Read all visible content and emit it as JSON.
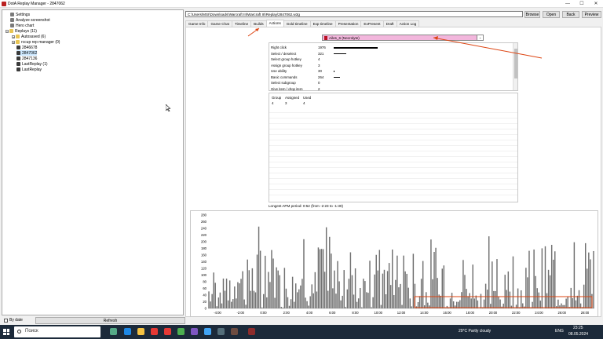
{
  "window": {
    "title": "DotA Replay Manager - 2847062",
    "minimize": "—",
    "maximize": "☐",
    "close": "✕"
  },
  "tree": {
    "items": [
      {
        "label": "Settings",
        "icon": "gear-icon"
      },
      {
        "label": "Analyze screenshot",
        "icon": "gear-icon"
      },
      {
        "label": "Hero chart",
        "icon": "gear-icon"
      },
      {
        "label": "Replays (11)",
        "icon": "folder-icon"
      },
      {
        "label": "Autosaved (6)",
        "icon": "folder-icon"
      },
      {
        "label": "rccup rep manager (0)",
        "icon": "folder-icon"
      },
      {
        "label": "2846678",
        "icon": "replay-icon"
      },
      {
        "label": "2847062",
        "icon": "replay-icon"
      },
      {
        "label": "2847136",
        "icon": "replay-icon"
      },
      {
        "label": "LastReplay (1)",
        "icon": "replay-icon"
      },
      {
        "label": "LastReplay",
        "icon": "replay-icon"
      }
    ]
  },
  "bottom_left": {
    "by_date_label": "By date",
    "refresh_label": "Refresh"
  },
  "path_bar": {
    "path": "C:\\Users\\MSI\\Downloads\\Warcraft III\\Warcraft III\\Replay\\2847062.w3g",
    "browse": "Browse",
    "open": "Open",
    "back": "Back",
    "preview": "Preview"
  },
  "tabs": [
    "Game Info",
    "Game Chat",
    "Timeline",
    "Builds",
    "Actions",
    "Gold timeline",
    "Exp timeline",
    "Presentation",
    "ExPresent",
    "Draft",
    "Action Log"
  ],
  "active_tab": "Actions",
  "player": {
    "name": "Ailes_6 (Necrolyte)",
    "dropdown": "⌄"
  },
  "actions": [
    {
      "name": "Right click",
      "value": "1976",
      "bar": 1.0
    },
    {
      "name": "Select / deselect",
      "value": "321",
      "bar": 0.29
    },
    {
      "name": "Select group hotkey",
      "value": "4",
      "bar": 0
    },
    {
      "name": "Assign group hotkey",
      "value": "3",
      "bar": 0
    },
    {
      "name": "Use ability",
      "value": "30",
      "bar": 0.02
    },
    {
      "name": "Basic commands",
      "value": "264",
      "bar": 0.14
    },
    {
      "name": "Select subgroup",
      "value": "0",
      "bar": 0
    },
    {
      "name": "Give item / drop item",
      "value": "2",
      "bar": 0
    }
  ],
  "groups": {
    "headers": [
      "Group",
      "Assigned",
      "Used"
    ],
    "rows": [
      [
        "4",
        "3",
        "4"
      ]
    ]
  },
  "longest_apm": "Longest APM period: 0:52 (from -2:23 to -1:30)",
  "chart_data": {
    "type": "bar",
    "title": "",
    "xlabel": "",
    "ylabel": "",
    "ylim": [
      0,
      280
    ],
    "yticks": [
      "0",
      "20",
      "40",
      "60",
      "80",
      "100",
      "120",
      "140",
      "160",
      "180",
      "200",
      "220",
      "240",
      "260",
      "280"
    ],
    "xticks": [
      "-4:00",
      "-2:00",
      "0:00",
      "2:00",
      "4:00",
      "6:00",
      "8:00",
      "10:00",
      "12:00",
      "14:00",
      "16:00",
      "18:00",
      "20:00",
      "22:00",
      "24:00",
      "26:00",
      "28:00"
    ],
    "bar_color": "#707070",
    "segments": [
      {
        "from": 0,
        "to": 0.08,
        "base": 85,
        "amp": 80
      },
      {
        "from": 0.08,
        "to": 0.55,
        "base": 120,
        "amp": 150
      },
      {
        "from": 0.55,
        "to": 0.6,
        "base": 100,
        "amp": 170
      },
      {
        "from": 0.6,
        "to": 1.0,
        "base": 60,
        "amp": 170
      }
    ]
  },
  "taskbar": {
    "search_placeholder": "Поиск",
    "weather": "29°C  Partly cloudy",
    "lang": "ENG",
    "time": "23:25",
    "date": "08.05.2024"
  }
}
